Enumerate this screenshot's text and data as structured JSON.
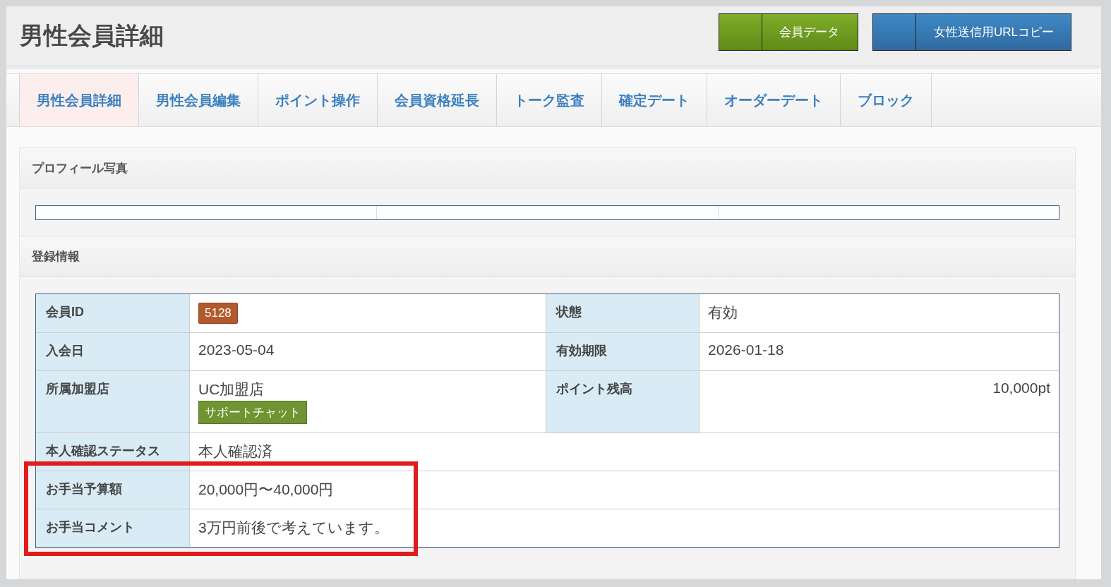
{
  "page_title": "男性会員詳細",
  "header_buttons": [
    {
      "label": "会員データ",
      "kind": "success"
    },
    {
      "label": "女性送信用URLコピー",
      "kind": "primary"
    }
  ],
  "tabs": [
    {
      "label": "男性会員詳細",
      "selected": true
    },
    {
      "label": "男性会員編集",
      "selected": false
    },
    {
      "label": "ポイント操作",
      "selected": false
    },
    {
      "label": "会員資格延長",
      "selected": false
    },
    {
      "label": "トーク監査",
      "selected": false
    },
    {
      "label": "確定デート",
      "selected": false
    },
    {
      "label": "オーダーデート",
      "selected": false
    },
    {
      "label": "ブロック",
      "selected": false
    }
  ],
  "profile_photo": {
    "title": "プロフィール写真"
  },
  "registration": {
    "title": "登録情報",
    "rows": [
      {
        "highlighted": false,
        "fields": [
          {
            "label": "会員ID",
            "kind": "badge",
            "value": "5128"
          },
          {
            "label": "状態",
            "kind": "text",
            "value": "有効"
          }
        ]
      },
      {
        "highlighted": false,
        "fields": [
          {
            "label": "入会日",
            "kind": "text",
            "value": "2023-05-04"
          },
          {
            "label": "有効期限",
            "kind": "text",
            "value": "2026-01-18"
          }
        ]
      },
      {
        "highlighted": false,
        "fields": [
          {
            "label": "所属加盟店",
            "kind": "text_with_button",
            "value": "UC加盟店",
            "button": "サポートチャット"
          },
          {
            "label": "ポイント残高",
            "kind": "number",
            "value": "10,000pt"
          }
        ]
      },
      {
        "highlighted": false,
        "fields": [
          {
            "label": "本人確認ステータス",
            "kind": "text",
            "value": "本人確認済"
          }
        ]
      },
      {
        "highlighted": true,
        "fields": [
          {
            "label": "お手当予算額",
            "kind": "text",
            "value": "20,000円〜40,000円"
          }
        ]
      },
      {
        "highlighted": true,
        "fields": [
          {
            "label": "お手当コメント",
            "kind": "text",
            "value": "3万円前後で考えています。"
          }
        ]
      }
    ]
  }
}
